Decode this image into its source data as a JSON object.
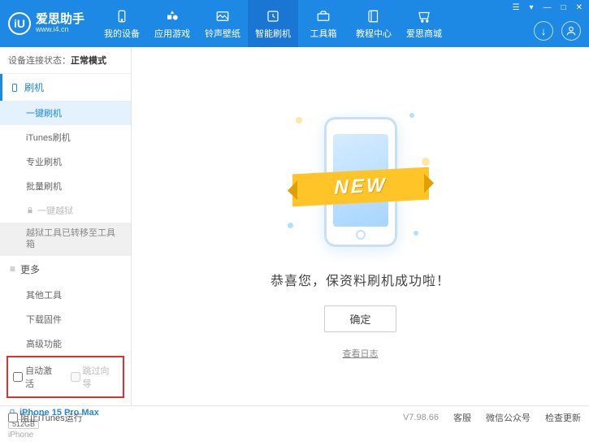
{
  "header": {
    "logo_letter": "iU",
    "title": "爱思助手",
    "url": "www.i4.cn",
    "nav": [
      {
        "label": "我的设备"
      },
      {
        "label": "应用游戏"
      },
      {
        "label": "铃声壁纸"
      },
      {
        "label": "智能刷机"
      },
      {
        "label": "工具箱"
      },
      {
        "label": "教程中心"
      },
      {
        "label": "爱思商城"
      }
    ]
  },
  "sidebar": {
    "status_label": "设备连接状态：",
    "status_value": "正常模式",
    "section_flash": "刷机",
    "items_flash": [
      "一键刷机",
      "iTunes刷机",
      "专业刷机",
      "批量刷机"
    ],
    "locked_label": "一键越狱",
    "moved_label": "越狱工具已转移至工具箱",
    "section_more": "更多",
    "items_more": [
      "其他工具",
      "下载固件",
      "高级功能"
    ],
    "chk_auto": "自动激活",
    "chk_skip": "跳过向导",
    "device": {
      "name": "iPhone 15 Pro Max",
      "storage": "512GB",
      "type": "iPhone"
    }
  },
  "main": {
    "new_text": "NEW",
    "success": "恭喜您，保资料刷机成功啦！",
    "ok": "确定",
    "view_log": "查看日志"
  },
  "footer": {
    "block_itunes": "阻止iTunes运行",
    "version": "V7.98.66",
    "support": "客服",
    "wechat": "微信公众号",
    "update": "检查更新"
  }
}
